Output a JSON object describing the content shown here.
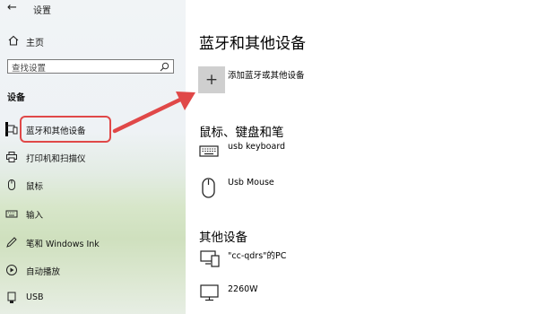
{
  "window": {
    "title": "设置",
    "back_icon": "back-arrow-icon"
  },
  "sidebar": {
    "home_label": "主页",
    "search_placeholder": "查找设置",
    "section_heading": "设备",
    "items": [
      {
        "label": "蓝牙和其他设备",
        "icon": "bluetooth-devices-icon",
        "selected": true
      },
      {
        "label": "打印机和扫描仪",
        "icon": "printer-icon"
      },
      {
        "label": "鼠标",
        "icon": "mouse-icon"
      },
      {
        "label": "输入",
        "icon": "keyboard-icon"
      },
      {
        "label": "笔和 Windows Ink",
        "icon": "pen-icon"
      },
      {
        "label": "自动播放",
        "icon": "autoplay-icon"
      },
      {
        "label": "USB",
        "icon": "usb-icon"
      }
    ]
  },
  "main": {
    "title": "蓝牙和其他设备",
    "add_device_label": "添加蓝牙或其他设备",
    "sections": [
      {
        "heading": "鼠标、键盘和笔",
        "devices": [
          {
            "name": "usb keyboard",
            "icon": "keyboard-icon"
          },
          {
            "name": "Usb Mouse",
            "icon": "mouse-icon"
          }
        ]
      },
      {
        "heading": "其他设备",
        "devices": [
          {
            "name": "\"cc-qdrs\"的PC",
            "icon": "computer-icon"
          },
          {
            "name": "2260W",
            "icon": "monitor-icon"
          }
        ]
      }
    ]
  },
  "annotation": {
    "highlight_color": "#e04848"
  }
}
